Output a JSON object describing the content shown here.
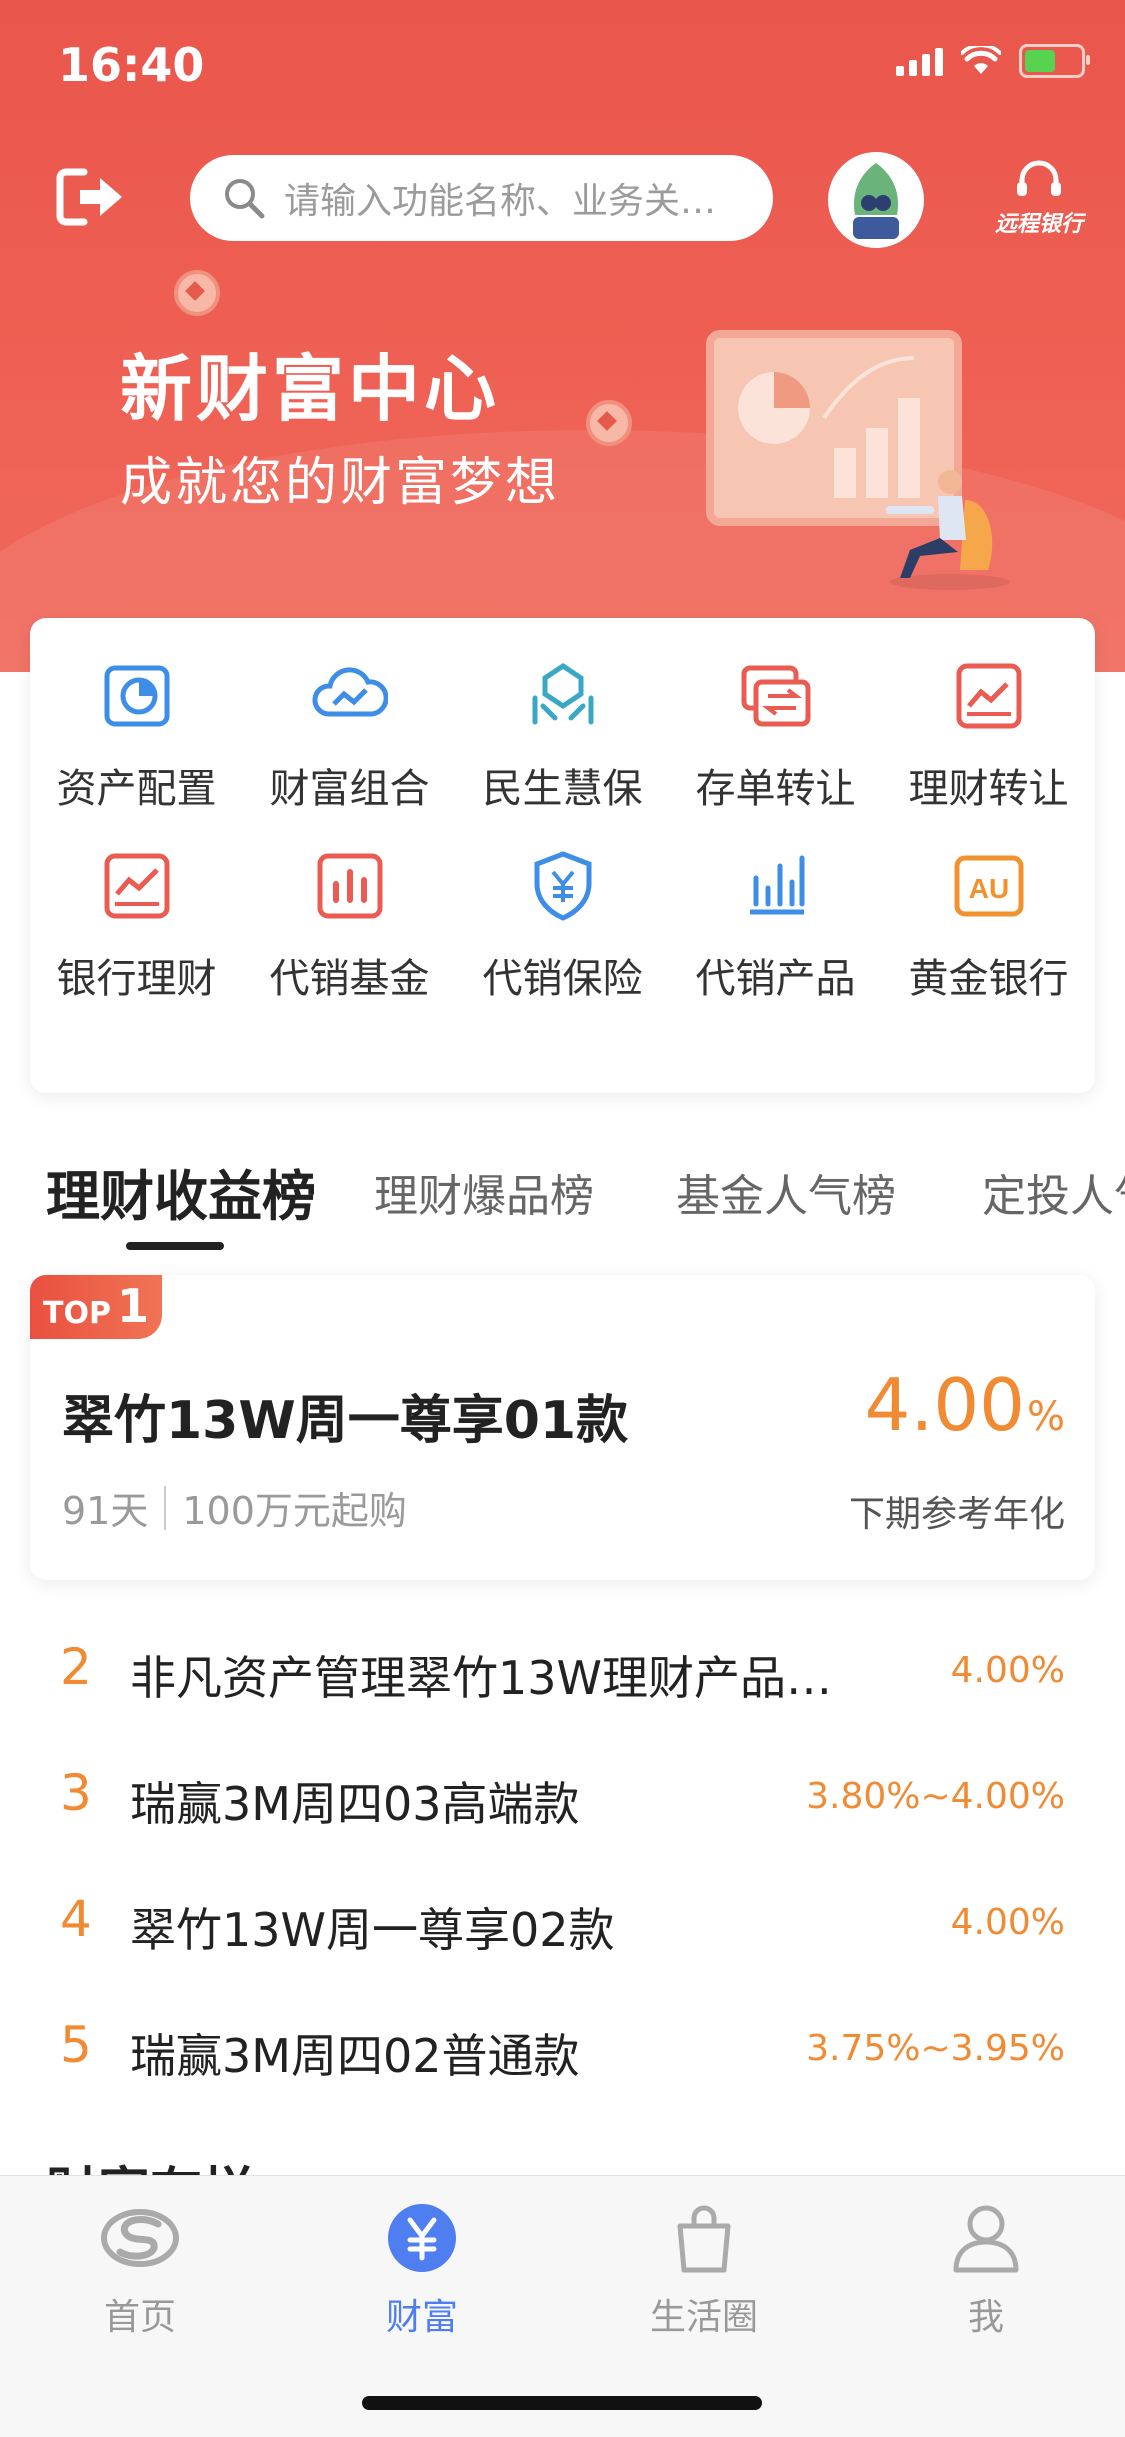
{
  "status_bar": {
    "time": "16:40"
  },
  "header": {
    "search_placeholder": "请输入功能名称、业务关…",
    "remote_bank_label": "远程银行"
  },
  "hero": {
    "title": "新财富中心",
    "subtitle": "成就您的财富梦想"
  },
  "services": [
    {
      "label": "资产配置",
      "icon": "asset-allocation-icon",
      "color": "#3e8ee8"
    },
    {
      "label": "财富组合",
      "icon": "wealth-portfolio-icon",
      "color": "#3e8ee8"
    },
    {
      "label": "民生慧保",
      "icon": "insurance-hands-icon",
      "color": "#3aa7c6"
    },
    {
      "label": "存单转让",
      "icon": "deposit-transfer-icon",
      "color": "#ea5b52"
    },
    {
      "label": "理财转让",
      "icon": "wealth-transfer-icon",
      "color": "#ea5b52"
    },
    {
      "label": "银行理财",
      "icon": "bank-wealth-icon",
      "color": "#ea5b52"
    },
    {
      "label": "代销基金",
      "icon": "fund-bars-icon",
      "color": "#ea5b52"
    },
    {
      "label": "代销保险",
      "icon": "shield-yuan-icon",
      "color": "#3e8ee8"
    },
    {
      "label": "代销产品",
      "icon": "products-bars-icon",
      "color": "#3e8ee8"
    },
    {
      "label": "黄金银行",
      "icon": "gold-au-icon",
      "color": "#f0922e"
    }
  ],
  "tabs": [
    {
      "label": "理财收益榜",
      "active": true
    },
    {
      "label": "理财爆品榜",
      "active": false
    },
    {
      "label": "基金人气榜",
      "active": false
    },
    {
      "label": "定投人气",
      "active": false
    }
  ],
  "top_product": {
    "badge_prefix": "TOP",
    "badge_rank": "1",
    "name": "翠竹13W周一尊享01款",
    "rate": "4.00",
    "rate_unit": "%",
    "term": "91天",
    "min_purchase": "100万元起购",
    "rate_note": "下期参考年化"
  },
  "rank_list": [
    {
      "rank": "2",
      "name": "非凡资产管理翠竹13W理财产品…",
      "rate": "4.00%"
    },
    {
      "rank": "3",
      "name": "瑞赢3M周四03高端款",
      "rate": "3.80%~4.00%"
    },
    {
      "rank": "4",
      "name": "翠竹13W周一尊享02款",
      "rate": "4.00%"
    },
    {
      "rank": "5",
      "name": "瑞赢3M周四02普通款",
      "rate": "3.75%~3.95%"
    }
  ],
  "section_peek": "财富有样",
  "bottom_nav": [
    {
      "label": "首页",
      "active": false
    },
    {
      "label": "财富",
      "active": true
    },
    {
      "label": "生活圈",
      "active": false
    },
    {
      "label": "我",
      "active": false
    }
  ],
  "colors": {
    "brand_red": "#ea5446",
    "accent_orange": "#f08a33",
    "active_blue": "#4f7ef0"
  }
}
